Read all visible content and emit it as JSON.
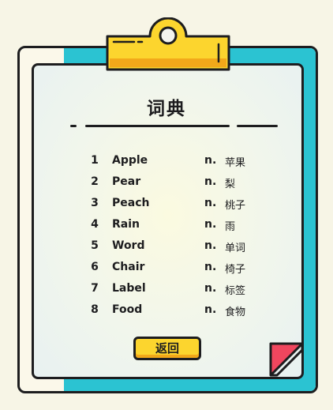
{
  "title": "词典",
  "entries": [
    {
      "num": "1",
      "word": "Apple",
      "pos": "n.",
      "meaning": "苹果"
    },
    {
      "num": "2",
      "word": "Pear",
      "pos": "n.",
      "meaning": "梨"
    },
    {
      "num": "3",
      "word": "Peach",
      "pos": "n.",
      "meaning": "桃子"
    },
    {
      "num": "4",
      "word": "Rain",
      "pos": "n.",
      "meaning": "雨"
    },
    {
      "num": "5",
      "word": "Word",
      "pos": "n.",
      "meaning": "单词"
    },
    {
      "num": "6",
      "word": "Chair",
      "pos": "n.",
      "meaning": "椅子"
    },
    {
      "num": "7",
      "word": "Label",
      "pos": "n.",
      "meaning": "标签"
    },
    {
      "num": "8",
      "word": "Food",
      "pos": "n.",
      "meaning": "食物"
    }
  ],
  "back_button": "返回",
  "colors": {
    "background": "#f7f5e6",
    "board_cyan": "#2bc3d2",
    "clip_yellow": "#fcd52e",
    "button_yellow": "#fcd52e",
    "fold_red": "#f0465e",
    "outline": "#1d1d1f"
  }
}
